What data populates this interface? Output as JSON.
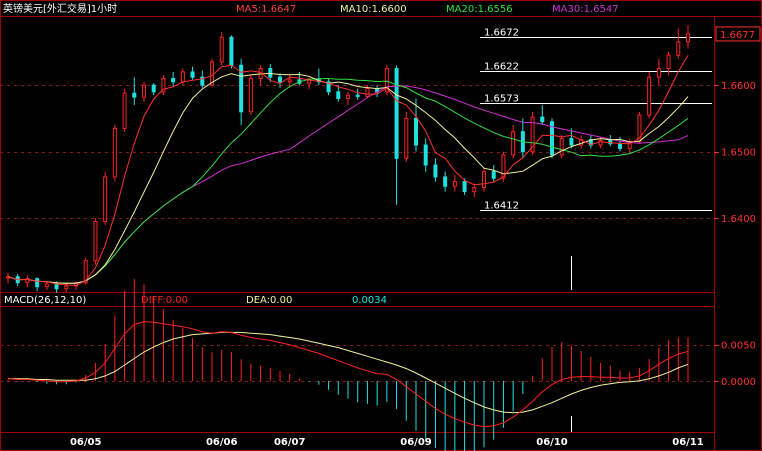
{
  "title": "英镑美元[外汇交易]1小时",
  "colors": {
    "bg": "#000000",
    "frame": "#a00000",
    "grid": "#8a1a1a",
    "up": "#ff2020",
    "down": "#20e0e0",
    "ma5": "#ffffff",
    "ma10": "#f2f29a",
    "ma20": "#30e040",
    "ma30": "#d030d0",
    "diff": "#ff2020",
    "dea": "#f2f29a",
    "title": "#ffffff",
    "axis_text": "#ff3030",
    "date_text": "#ffffff"
  },
  "legend": [
    {
      "key": "ma5",
      "label": "MA5:1.6647"
    },
    {
      "key": "ma10",
      "label": "MA10:1.6600"
    },
    {
      "key": "ma20",
      "label": "MA20:1.6556"
    },
    {
      "key": "ma30",
      "label": "MA30:1.6547"
    }
  ],
  "macd_legend": {
    "name": "MACD(26,12,10)",
    "diff": "DIFF:0.00",
    "dea": "DEA:0.00",
    "hist": "0.0034"
  },
  "price_axis": {
    "ticks": [
      {
        "value": 1.66,
        "label": "1.6600"
      },
      {
        "value": 1.65,
        "label": "1.6500"
      },
      {
        "value": 1.64,
        "label": "1.6400"
      }
    ],
    "last_price": {
      "value": 1.6677,
      "label": "1.6677"
    },
    "ylim": [
      1.6295,
      1.6695
    ]
  },
  "macd_axis": {
    "ticks": [
      {
        "value": 0.005,
        "label": "0.0050"
      },
      {
        "value": 0.0,
        "label": "0.0000"
      }
    ],
    "ylim": [
      -0.0065,
      0.0098
    ]
  },
  "levels": [
    {
      "value": 1.6672,
      "label": "1.6672"
    },
    {
      "value": 1.6622,
      "label": "1.6622"
    },
    {
      "value": 1.6573,
      "label": "1.6573"
    },
    {
      "value": 1.6412,
      "label": "1.6412"
    }
  ],
  "dates": [
    {
      "index": 8,
      "label": "06/05"
    },
    {
      "index": 22,
      "label": "06/06"
    },
    {
      "index": 29,
      "label": "06/07"
    },
    {
      "index": 42,
      "label": "06/09"
    },
    {
      "index": 56,
      "label": "06/10"
    },
    {
      "index": 70,
      "label": "06/11"
    }
  ],
  "chart_data": {
    "type": "candlestick",
    "title": "英镑美元[外汇交易]1小时",
    "candles": [
      [
        1.631,
        1.6318,
        1.6302,
        1.6312
      ],
      [
        1.6312,
        1.6316,
        1.6298,
        1.6303
      ],
      [
        1.6303,
        1.6314,
        1.6296,
        1.6309
      ],
      [
        1.6309,
        1.6311,
        1.629,
        1.6297
      ],
      [
        1.6297,
        1.6306,
        1.6292,
        1.6301
      ],
      [
        1.6301,
        1.6305,
        1.6288,
        1.6294
      ],
      [
        1.6294,
        1.6301,
        1.6289,
        1.6298
      ],
      [
        1.6298,
        1.6305,
        1.6292,
        1.6303
      ],
      [
        1.6303,
        1.634,
        1.63,
        1.6336
      ],
      [
        1.6336,
        1.64,
        1.633,
        1.6395
      ],
      [
        1.6395,
        1.647,
        1.639,
        1.6462
      ],
      [
        1.6462,
        1.654,
        1.6455,
        1.6535
      ],
      [
        1.6535,
        1.6595,
        1.653,
        1.6588
      ],
      [
        1.6588,
        1.6612,
        1.657,
        1.6582
      ],
      [
        1.6582,
        1.6605,
        1.6575,
        1.66
      ],
      [
        1.66,
        1.6603,
        1.6585,
        1.659
      ],
      [
        1.659,
        1.6615,
        1.6585,
        1.661
      ],
      [
        1.661,
        1.662,
        1.6598,
        1.6605
      ],
      [
        1.6605,
        1.6625,
        1.66,
        1.662
      ],
      [
        1.662,
        1.6628,
        1.6608,
        1.6612
      ],
      [
        1.6612,
        1.6622,
        1.6596,
        1.66
      ],
      [
        1.66,
        1.664,
        1.6598,
        1.6635
      ],
      [
        1.6635,
        1.668,
        1.663,
        1.6672
      ],
      [
        1.6672,
        1.6675,
        1.6625,
        1.663
      ],
      [
        1.663,
        1.664,
        1.654,
        1.656
      ],
      [
        1.656,
        1.6615,
        1.6555,
        1.661
      ],
      [
        1.661,
        1.663,
        1.66,
        1.6625
      ],
      [
        1.6625,
        1.6632,
        1.6605,
        1.6612
      ],
      [
        1.6612,
        1.6618,
        1.6596,
        1.6605
      ],
      [
        1.6605,
        1.6615,
        1.6596,
        1.6608
      ],
      [
        1.6608,
        1.662,
        1.66,
        1.6603
      ],
      [
        1.6603,
        1.6612,
        1.6594,
        1.6609
      ],
      [
        1.6609,
        1.6625,
        1.66,
        1.6605
      ],
      [
        1.6605,
        1.661,
        1.6585,
        1.659
      ],
      [
        1.659,
        1.66,
        1.6575,
        1.658
      ],
      [
        1.658,
        1.659,
        1.657,
        1.6585
      ],
      [
        1.6585,
        1.6595,
        1.6578,
        1.6583
      ],
      [
        1.6583,
        1.66,
        1.658,
        1.6595
      ],
      [
        1.6595,
        1.66,
        1.6582,
        1.659
      ],
      [
        1.659,
        1.663,
        1.6585,
        1.6625
      ],
      [
        1.6625,
        1.663,
        1.642,
        1.649
      ],
      [
        1.649,
        1.656,
        1.6485,
        1.655
      ],
      [
        1.655,
        1.658,
        1.65,
        1.651
      ],
      [
        1.651,
        1.652,
        1.647,
        1.648
      ],
      [
        1.648,
        1.649,
        1.6455,
        1.6462
      ],
      [
        1.6462,
        1.647,
        1.644,
        1.6448
      ],
      [
        1.6448,
        1.6465,
        1.644,
        1.6455
      ],
      [
        1.6455,
        1.646,
        1.6435,
        1.644
      ],
      [
        1.644,
        1.6452,
        1.6432,
        1.6446
      ],
      [
        1.6446,
        1.6475,
        1.644,
        1.647
      ],
      [
        1.647,
        1.648,
        1.6455,
        1.646
      ],
      [
        1.646,
        1.65,
        1.6455,
        1.6495
      ],
      [
        1.6495,
        1.654,
        1.649,
        1.653
      ],
      [
        1.653,
        1.655,
        1.649,
        1.65
      ],
      [
        1.65,
        1.656,
        1.6495,
        1.6552
      ],
      [
        1.6552,
        1.657,
        1.654,
        1.6545
      ],
      [
        1.6545,
        1.655,
        1.649,
        1.6495
      ],
      [
        1.6495,
        1.6525,
        1.649,
        1.652
      ],
      [
        1.652,
        1.6535,
        1.6505,
        1.651
      ],
      [
        1.651,
        1.6525,
        1.6505,
        1.6518
      ],
      [
        1.6518,
        1.6525,
        1.6505,
        1.651
      ],
      [
        1.651,
        1.6522,
        1.6505,
        1.6517
      ],
      [
        1.6517,
        1.6525,
        1.6508,
        1.6512
      ],
      [
        1.6512,
        1.6522,
        1.65,
        1.6505
      ],
      [
        1.6505,
        1.652,
        1.6498,
        1.6515
      ],
      [
        1.6515,
        1.656,
        1.6512,
        1.6555
      ],
      [
        1.6555,
        1.662,
        1.655,
        1.6612
      ],
      [
        1.6612,
        1.664,
        1.66,
        1.6625
      ],
      [
        1.6625,
        1.665,
        1.6615,
        1.6645
      ],
      [
        1.6645,
        1.6685,
        1.664,
        1.6665
      ],
      [
        1.6665,
        1.669,
        1.6655,
        1.6677
      ]
    ],
    "macd": {
      "diff": [
        0.0003,
        0.0002,
        0.0002,
        0.0001,
        0.0,
        -0.0001,
        -0.0001,
        0.0,
        0.0004,
        0.0012,
        0.0025,
        0.0045,
        0.0065,
        0.0078,
        0.0082,
        0.0081,
        0.0079,
        0.0077,
        0.0075,
        0.0072,
        0.0068,
        0.0066,
        0.0068,
        0.0067,
        0.0063,
        0.006,
        0.0058,
        0.0056,
        0.0053,
        0.005,
        0.0046,
        0.0042,
        0.0038,
        0.0033,
        0.0028,
        0.0023,
        0.0018,
        0.0014,
        0.001,
        0.0009,
        0.0002,
        -0.0008,
        -0.0018,
        -0.0028,
        -0.0038,
        -0.0046,
        -0.0052,
        -0.0057,
        -0.0061,
        -0.0063,
        -0.0062,
        -0.0058,
        -0.005,
        -0.004,
        -0.0028,
        -0.0015,
        -0.0005,
        0.0002,
        0.0005,
        0.0006,
        0.0006,
        0.0005,
        0.0005,
        0.0004,
        0.0004,
        0.0007,
        0.0014,
        0.0023,
        0.0031,
        0.0037,
        0.0041
      ],
      "dea": [
        0.0003,
        0.0003,
        0.0003,
        0.0002,
        0.0002,
        0.0001,
        0.0001,
        0.0001,
        0.0001,
        0.0003,
        0.0007,
        0.0013,
        0.0022,
        0.0031,
        0.004,
        0.0047,
        0.0053,
        0.0058,
        0.0061,
        0.0064,
        0.0065,
        0.0066,
        0.0067,
        0.0067,
        0.0067,
        0.0066,
        0.0065,
        0.0064,
        0.0062,
        0.006,
        0.0058,
        0.0055,
        0.0052,
        0.0049,
        0.0046,
        0.0042,
        0.0038,
        0.0034,
        0.003,
        0.0026,
        0.0022,
        0.0017,
        0.0011,
        0.0004,
        -0.0003,
        -0.001,
        -0.0017,
        -0.0024,
        -0.003,
        -0.0036,
        -0.004,
        -0.0043,
        -0.0044,
        -0.0043,
        -0.004,
        -0.0035,
        -0.003,
        -0.0024,
        -0.0018,
        -0.0013,
        -0.0009,
        -0.0006,
        -0.0004,
        -0.0002,
        -0.0001,
        0.0,
        0.0003,
        0.0007,
        0.0012,
        0.0018,
        0.0023
      ]
    }
  }
}
